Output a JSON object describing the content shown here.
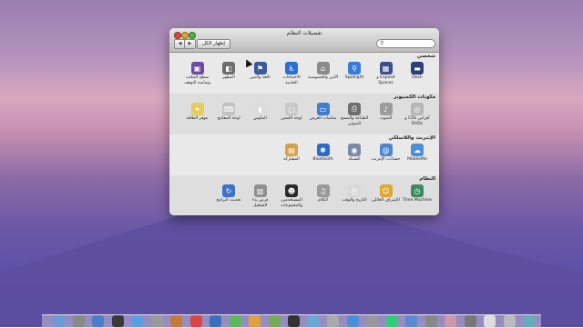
{
  "window": {
    "title": "تفضيلات النظام",
    "show_all_label": "إظهار الكل",
    "nav_back": "◀",
    "nav_forward": "▶",
    "search_placeholder": ""
  },
  "sections": [
    {
      "title": "شخصي",
      "items": [
        {
          "id": "dock",
          "label": "Dock",
          "icon": "dock-icon",
          "color": "#2b3f7a",
          "glyph": "▬"
        },
        {
          "id": "expose",
          "label": "Exposé و Spaces",
          "icon": "expose-icon",
          "color": "#3b4f8f",
          "glyph": "▦"
        },
        {
          "id": "spotlight",
          "label": "Spotlight",
          "icon": "spotlight-icon",
          "color": "#3a7bd5",
          "glyph": "⚲"
        },
        {
          "id": "security",
          "label": "الأمن والخصوصية",
          "icon": "security-icon",
          "color": "#8a8a8a",
          "glyph": "⌂"
        },
        {
          "id": "universal",
          "label": "الاحتياجات الخاصة",
          "icon": "universal-access-icon",
          "color": "#2d6fd0",
          "glyph": "♿"
        },
        {
          "id": "language",
          "label": "اللغة والنص",
          "icon": "language-icon",
          "color": "#3d5b9b",
          "glyph": "⚑"
        },
        {
          "id": "appearance",
          "label": "المظهر",
          "icon": "appearance-icon",
          "color": "#6e6e6e",
          "glyph": "◧"
        },
        {
          "id": "desktop",
          "label": "سطح المكتب وشاشة التوقف",
          "icon": "desktop-icon",
          "color": "#6b4aa0",
          "glyph": "▣"
        }
      ]
    },
    {
      "title": "مكونات الكمبيوتر",
      "items": [
        {
          "id": "cds",
          "label": "أقراص CDs و DVDs",
          "icon": "cd-icon",
          "color": "#b7b7b7",
          "glyph": "◎"
        },
        {
          "id": "sound",
          "label": "الصوت",
          "icon": "sound-icon",
          "color": "#9c9c9c",
          "glyph": "♪"
        },
        {
          "id": "print",
          "label": "الطباعة والمسح الضوئي",
          "icon": "printer-icon",
          "color": "#6f6f6f",
          "glyph": "⎙"
        },
        {
          "id": "displays",
          "label": "شاشات العرض",
          "icon": "display-icon",
          "color": "#3d7fcf",
          "glyph": "▭"
        },
        {
          "id": "trackpad",
          "label": "لوحة اللمس",
          "icon": "trackpad-icon",
          "color": "#c8c8c8",
          "glyph": "▢"
        },
        {
          "id": "mouse",
          "label": "الماوس",
          "icon": "mouse-icon",
          "color": "#dcdcdc",
          "glyph": "◖"
        },
        {
          "id": "keyboard",
          "label": "لوحة المفاتيح",
          "icon": "keyboard-icon",
          "color": "#c0c0c0",
          "glyph": "⌨"
        },
        {
          "id": "energy",
          "label": "موفر الطاقة",
          "icon": "energy-icon",
          "color": "#e6cc5c",
          "glyph": "✦"
        }
      ]
    },
    {
      "title": "الإنترنت واللاسلكي",
      "items": [
        {
          "id": "mobileme",
          "label": "MobileMe",
          "icon": "mobileme-icon",
          "color": "#4b8fd6",
          "glyph": "☁"
        },
        {
          "id": "accounts",
          "label": "حسابات الإنترنت",
          "icon": "mail-icon",
          "color": "#4a87d0",
          "glyph": "@"
        },
        {
          "id": "network",
          "label": "الشبكة",
          "icon": "network-icon",
          "color": "#7a8aa6",
          "glyph": "◉"
        },
        {
          "id": "bluetooth",
          "label": "Bluetooth",
          "icon": "bluetooth-icon",
          "color": "#2f6bc5",
          "glyph": "✱"
        },
        {
          "id": "sharing",
          "label": "المشاركة",
          "icon": "sharing-icon",
          "color": "#d4a24a",
          "glyph": "▤"
        }
      ]
    },
    {
      "title": "النظام",
      "items": [
        {
          "id": "timemachine",
          "label": "Time Machine",
          "icon": "time-machine-icon",
          "color": "#3d8a5e",
          "glyph": "◷"
        },
        {
          "id": "parental",
          "label": "الإشراف العائلي",
          "icon": "parental-controls-icon",
          "color": "#e0a72e",
          "glyph": "☺"
        },
        {
          "id": "datetime",
          "label": "التاريخ والوقت",
          "icon": "clock-icon",
          "color": "#d9d9d9",
          "glyph": "◴"
        },
        {
          "id": "speech",
          "label": "الكلام",
          "icon": "microphone-icon",
          "color": "#9a9a9a",
          "glyph": "♫"
        },
        {
          "id": "users",
          "label": "المستخدمين والمجموعات",
          "icon": "users-icon",
          "color": "#2a2a2a",
          "glyph": "☻"
        },
        {
          "id": "startup",
          "label": "قرص بدء التشغيل",
          "icon": "disk-icon",
          "color": "#8f8f8f",
          "glyph": "▥"
        },
        {
          "id": "update",
          "label": "تحديث البرامج",
          "icon": "software-update-icon",
          "color": "#3b73c8",
          "glyph": "↻"
        }
      ]
    }
  ]
}
